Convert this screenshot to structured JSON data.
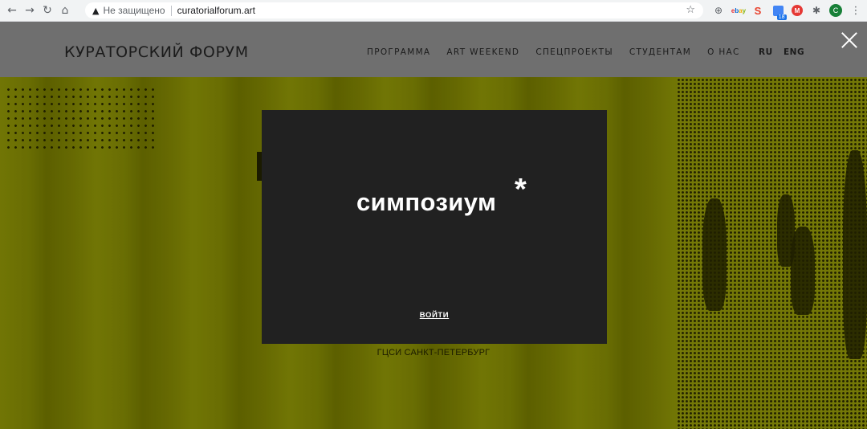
{
  "browser": {
    "security_label": "Не защищено",
    "url": "curatorialforum.art",
    "icons": {
      "back": "arrow-left-icon",
      "forward": "arrow-right-icon",
      "reload": "reload-icon",
      "home": "home-icon",
      "warning": "warning-icon",
      "bookmark": "star-icon",
      "menu": "kebab-menu-icon"
    },
    "extensions": {
      "zoom": "zoom-icon",
      "ebay_label": "ebay",
      "s_label": "S",
      "calendar_badge": "18",
      "m_label": "M",
      "puzzle": "puzzle-icon",
      "profile_initial": "C"
    }
  },
  "site": {
    "logo": "КУРАТОРСКИЙ ФОРУМ",
    "nav": {
      "program": "ПРОГРАММА",
      "art_weekend": "ART WEEKEND",
      "special": "СПЕЦПРОЕКТЫ",
      "students": "СТУДЕНТАМ",
      "about": "О НАС"
    },
    "lang": {
      "ru": "RU",
      "eng": "ENG"
    },
    "caption": "ГЦСИ САНКТ-ПЕТЕРБУРГ"
  },
  "modal": {
    "brand": "симпозиум",
    "asterisk": "*",
    "login": "ВОЙТИ"
  },
  "colors": {
    "accent_olive": "#6b7000",
    "header_gray": "#6f6f6f",
    "modal_bg": "#212121"
  }
}
